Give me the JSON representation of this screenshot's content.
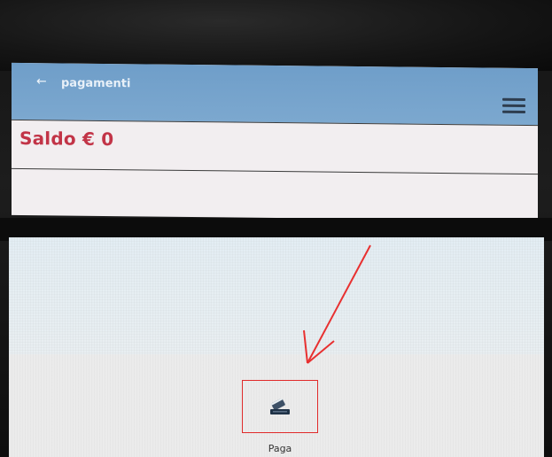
{
  "top_screen": {
    "appbar": {
      "back_icon": "arrow-left-icon",
      "title": "pagamenti",
      "menu_icon": "hamburger-menu-icon"
    },
    "balance_text": "Saldo € 0",
    "accent_color": "#c23447",
    "appbar_color": "#7ca8cf"
  },
  "bottom_screen": {
    "pay_button": {
      "icon": "card-payment-icon",
      "label": "Paga"
    },
    "annotation": {
      "type": "red-arrow-and-box",
      "color": "#e02a2a"
    }
  }
}
